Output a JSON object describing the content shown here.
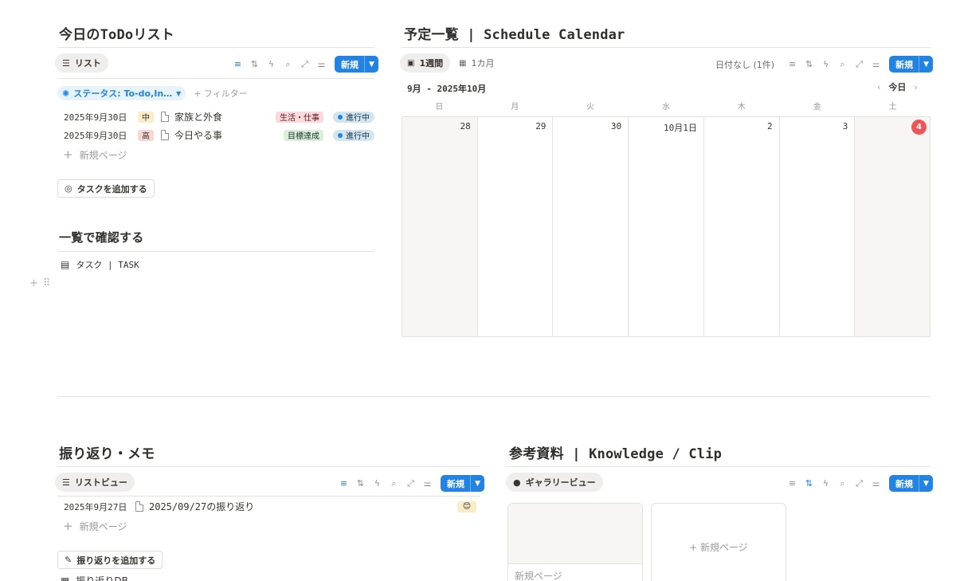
{
  "todo": {
    "title": "今日のToDoリスト",
    "view_label": "リスト",
    "new_label": "新規",
    "filter_chip": "ステータス: To-do,In…",
    "filter_add": "+ フィルター",
    "rows": [
      {
        "date": "2025年9月30日",
        "priority": "中",
        "priority_bg": "#fbecc8",
        "name": "家族と外食",
        "tag": "生活・仕事",
        "tag_bg": "#fadadd",
        "status": "進行中"
      },
      {
        "date": "2025年9月30日",
        "priority": "高",
        "priority_bg": "#fbd7d4",
        "name": "今日やる事",
        "tag": "目標達成",
        "tag_bg": "#dbeddb",
        "status": "進行中"
      }
    ],
    "new_page": "新規ページ",
    "add_task": "タスクを追加する"
  },
  "overview": {
    "title": "一覧で確認する",
    "db_link": "タスク | TASK"
  },
  "schedule": {
    "title": "予定一覧 | Schedule Calendar",
    "view_week": "1週間",
    "view_month": "1カ月",
    "no_date": "日付なし (1件)",
    "new_label": "新規",
    "month_label": "9月 - 2025年10月",
    "today_label": "今日",
    "weekdays": [
      "日",
      "月",
      "火",
      "水",
      "木",
      "金",
      "土"
    ],
    "days": [
      "28",
      "29",
      "30",
      "10月1日",
      "2",
      "3",
      "4"
    ]
  },
  "reflection": {
    "title": "振り返り・メモ",
    "view_label": "リストビュー",
    "new_label": "新規",
    "row_date": "2025年9月27日",
    "row_name": "2025/09/27の振り返り",
    "row_emoji": "😊",
    "new_page": "新規ページ",
    "add_button": "振り返りを追加する",
    "db_link": "振り返りDB"
  },
  "reference": {
    "title": "参考資料 | Knowledge / Clip",
    "view_label": "ギャラリービュー",
    "new_label": "新規",
    "card_title": "新規ページ",
    "new_card": "+ 新規ページ"
  },
  "colors": {
    "accent": "#2383e2",
    "today": "#eb5757"
  }
}
